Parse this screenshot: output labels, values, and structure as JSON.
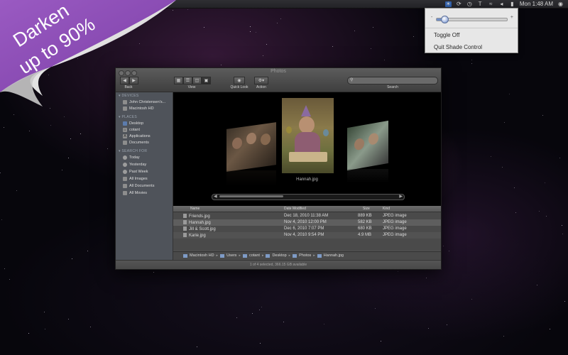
{
  "banner": {
    "line1": "Darken",
    "line2": "up to 90%"
  },
  "menubar": {
    "clock": "Mon 1:48 AM",
    "icons": [
      "shade-icon",
      "sync-icon",
      "clock-icon",
      "bluetooth-icon",
      "wifi-icon",
      "volume-icon",
      "battery-icon",
      "user-icon"
    ]
  },
  "shade_menu": {
    "slider_min": "-",
    "slider_max": "+",
    "brightness_level": 0.1,
    "items": [
      "Toggle Off",
      "Quit Shade Control"
    ]
  },
  "finder": {
    "title": "Photos",
    "toolbar": {
      "back": "Back",
      "view": "View",
      "quick_look": "Quick Look",
      "action": "Action",
      "search": "Search"
    },
    "sidebar": {
      "devices_header": "DEVICES",
      "devices": [
        "John Christensen's...",
        "Macintosh HD"
      ],
      "places_header": "PLACES",
      "places": [
        "Desktop",
        "cotant",
        "Applications",
        "Documents"
      ],
      "search_header": "SEARCH FOR",
      "searches": [
        "Today",
        "Yesterday",
        "Past Week",
        "All Images",
        "All Documents",
        "All Movies"
      ]
    },
    "coverflow": {
      "caption": "Hannah.jpg"
    },
    "columns": [
      "Name",
      "Date Modified",
      "Size",
      "Kind"
    ],
    "files": [
      {
        "name": "Friends.jpg",
        "date": "Dec 18, 2010 11:38 AM",
        "size": "889 KB",
        "kind": "JPEG image"
      },
      {
        "name": "Hannah.jpg",
        "date": "Nov 4, 2010 12:00 PM",
        "size": "582 KB",
        "kind": "JPEG image"
      },
      {
        "name": "Jill & Scott.jpg",
        "date": "Dec 6, 2010 7:07 PM",
        "size": "680 KB",
        "kind": "JPEG image"
      },
      {
        "name": "Karie.jpg",
        "date": "Nov 4, 2010 9:54 PM",
        "size": "4.9 MB",
        "kind": "JPEG image"
      }
    ],
    "path": [
      "Macintosh HD",
      "Users",
      "cotant",
      "Desktop",
      "Photos",
      "Hannah.jpg"
    ],
    "status": "1 of 4 selected, 366.15 GB available"
  }
}
